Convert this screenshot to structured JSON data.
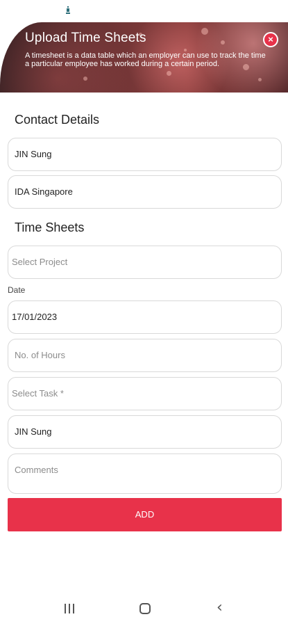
{
  "banner": {
    "title": "Upload Time Sheets",
    "description": "A timesheet is a data table which an employer can use to track the time a particular employee has worked during a certain period.",
    "close_icon": "close-icon",
    "accent": "#e8324a"
  },
  "contact_details": {
    "title": "Contact Details",
    "name_value": "JIN Sung",
    "company_value": "IDA Singapore"
  },
  "time_sheets": {
    "title": "Time Sheets",
    "project_placeholder": "Select Project",
    "date_label": "Date",
    "date_value": "17/01/2023",
    "hours_placeholder": "No. of Hours",
    "task_placeholder": "Select Task *",
    "employee_value": "JIN Sung",
    "comments_placeholder": "Comments",
    "add_label": "ADD"
  },
  "nav": {
    "recents_icon": "recents-icon",
    "home_icon": "home-icon",
    "back_icon": "back-icon"
  }
}
